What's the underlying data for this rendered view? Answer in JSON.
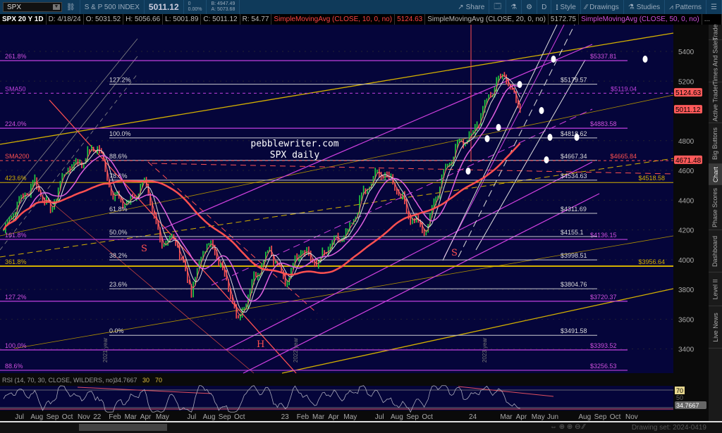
{
  "header": {
    "symbol": "SPX",
    "name": "S & P 500 INDEX",
    "last": "5011.12",
    "change": "0",
    "change_pct": "0.00%",
    "bid": "B: 4947.49",
    "ask": "A: 5073.68",
    "buttons": [
      "Share",
      "D",
      "Style",
      "Drawings",
      "Studies",
      "Patterns"
    ]
  },
  "info": {
    "period": "SPX 20 Y 1D",
    "date": "D: 4/18/24",
    "open": "O: 5031.52",
    "high": "H: 5056.66",
    "low": "L: 5001.89",
    "close": "C: 5011.12",
    "range": "R: 54.77",
    "sma10": "SimpleMovingAvg (CLOSE, 10, 0, no)",
    "sma10_val": "5124.63",
    "sma20": "SimpleMovingAvg (CLOSE, 20, 0, no)",
    "sma20_val": "5172.75",
    "sma50": "SimpleMovingAvg (CLOSE, 50, 0, no)",
    "more": "..."
  },
  "annotations": {
    "watermark1": "pebblewriter.com",
    "watermark2": "SPX daily",
    "s1": "S",
    "s2": "S",
    "h": "H",
    "year1": "2021 year",
    "year2": "2022 year",
    "year3": "2023 year"
  },
  "price_badges": [
    {
      "value": "5124.63"
    },
    {
      "value": "5011.12"
    },
    {
      "value": "4671.48"
    }
  ],
  "colors": {
    "bg": "#05053a",
    "white_fib": "#c8c8d0",
    "magenta": "#c040e0",
    "gold": "#d4b000",
    "red": "#ff5050"
  },
  "chart_data": {
    "type": "candlestick",
    "title": "SPX 20 Y 1D",
    "y_ticks": [
      5400,
      5200,
      4800,
      4600,
      4400,
      4200,
      4000,
      3800,
      3600,
      3400
    ],
    "ylim": [
      3250,
      5550
    ],
    "x_ticks": [
      "Jul",
      "Aug",
      "Sep",
      "Oct",
      "Nov",
      "22",
      "Feb",
      "Mar",
      "Apr",
      "May",
      "Jun",
      "Jul",
      "Aug",
      "Sep",
      "Oct",
      "Nov",
      "Dec",
      "23",
      "Feb",
      "Mar",
      "Apr",
      "May",
      "Jun",
      "Jul",
      "Aug",
      "Sep",
      "Oct",
      "Nov",
      "Dec",
      "24",
      "Feb",
      "Mar",
      "Apr",
      "May",
      "Jun",
      "Jul",
      "Aug",
      "Sep",
      "Oct",
      "Nov"
    ],
    "x_tick_show": [
      true,
      true,
      true,
      true,
      true,
      true,
      true,
      true,
      true,
      true,
      false,
      true,
      true,
      true,
      true,
      false,
      false,
      true,
      true,
      true,
      true,
      true,
      false,
      true,
      true,
      true,
      true,
      false,
      false,
      true,
      false,
      true,
      true,
      true,
      true,
      false,
      true,
      true,
      true,
      true
    ],
    "monthly_close_est": [
      4200,
      4390,
      4520,
      4330,
      4610,
      4660,
      4770,
      4430,
      4370,
      4530,
      4130,
      4130,
      3790,
      4130,
      3950,
      3590,
      3870,
      4080,
      3840,
      4080,
      3970,
      4110,
      4170,
      4450,
      4590,
      4510,
      4290,
      4190,
      4560,
      4770,
      4850,
      5100,
      5250,
      5011
    ],
    "fib_white": [
      {
        "pct": "127.2%",
        "price": "$5179.57",
        "v": 5179.57
      },
      {
        "pct": "100.0%",
        "price": "$4818.62",
        "v": 4818.62
      },
      {
        "pct": "88.6%",
        "price": "$4667.34",
        "v": 4667.34
      },
      {
        "pct": "78.6%",
        "price": "$4534.63",
        "v": 4534.63
      },
      {
        "pct": "61.8%",
        "price": "$4311.69",
        "v": 4311.69
      },
      {
        "pct": "50.0%",
        "price": "$4155.1",
        "v": 4155.1
      },
      {
        "pct": "38.2%",
        "price": "$3998.51",
        "v": 3998.51
      },
      {
        "pct": "23.6%",
        "price": "$3804.76",
        "v": 3804.76
      },
      {
        "pct": "0.0%",
        "price": "$3491.58",
        "v": 3491.58
      }
    ],
    "fib_magenta": [
      {
        "pct": "261.8%",
        "price": "$5337.81",
        "v": 5337.81
      },
      {
        "pct": "224.0%",
        "price": "$4883.58",
        "v": 4883.58
      },
      {
        "pct": "161.8%",
        "price": "$4136.15",
        "v": 4136.15
      },
      {
        "pct": "127.2%",
        "price": "$3720.37",
        "v": 3720.37
      },
      {
        "pct": "100.0%",
        "price": "$3393.52",
        "v": 3393.52
      },
      {
        "pct": "88.6%",
        "price": "$3256.53",
        "v": 3256.53
      }
    ],
    "sma_levels": [
      {
        "label": "SMA50",
        "price": "$5119.04",
        "v": 5119.04,
        "color": "#c040e0"
      },
      {
        "label": "SMA200",
        "price": "$4665.84",
        "v": 4665.84,
        "color": "#ff5050"
      }
    ],
    "gold_levels": [
      {
        "label": "423.6%",
        "price": "$4518.58",
        "v": 4518.58
      },
      {
        "label": "361.8%",
        "price": "$3956.64",
        "v": 3956.64
      }
    ],
    "rsi": {
      "label": "RSI (14, 70, 30, CLOSE, WILDERS, no)",
      "value": "34.7667",
      "lower": "30",
      "upper": "70",
      "ticks": [
        "70",
        "50"
      ]
    }
  },
  "tabs": [
    "Trade",
    "Times And Sales",
    "Active Trader",
    "Big Buttons",
    "Chart",
    "Phase Scores",
    "Dashboard",
    "Level II",
    "Live News"
  ],
  "footer": {
    "drawing_set": "Drawing set: 2024-0419"
  }
}
